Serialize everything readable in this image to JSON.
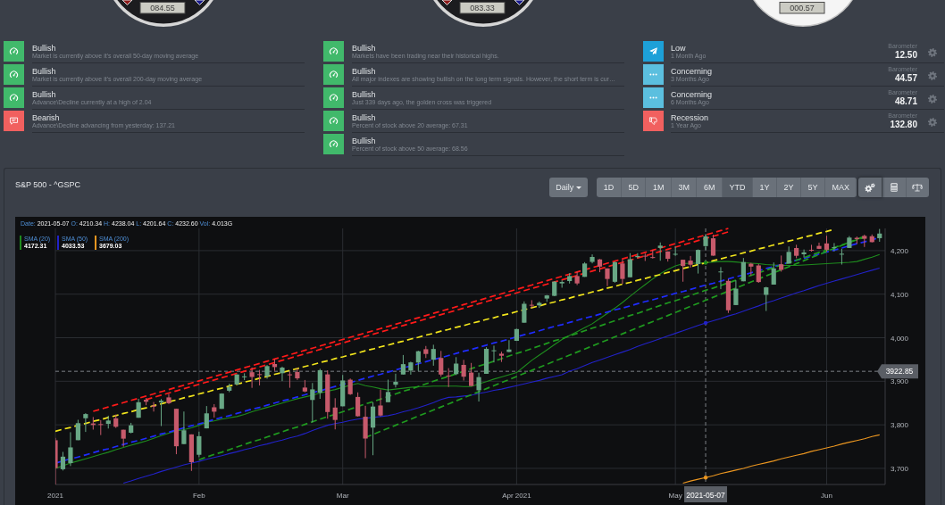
{
  "gauges": [
    {
      "kind": "dark",
      "reading": "084.55"
    },
    {
      "kind": "dark",
      "reading": "083.33"
    },
    {
      "kind": "light",
      "reading": "000.57"
    }
  ],
  "market_signals": [
    {
      "kind": "bullish",
      "title": "Bullish",
      "text": "Market is currently above it's overall 50-day moving average"
    },
    {
      "kind": "bullish",
      "title": "Bullish",
      "text": "Market is currently above it's overall 200-day moving average"
    },
    {
      "kind": "bullish",
      "title": "Bullish",
      "text": "Advance\\Decline currently at a high of 2.04"
    },
    {
      "kind": "bearish",
      "title": "Bearish",
      "text": "Advance\\Decline advancing from yesterday: 137.21"
    }
  ],
  "index_signals": [
    {
      "kind": "bullish",
      "title": "Bullish",
      "text": "Markets have been trading near their historical highs."
    },
    {
      "kind": "bullish",
      "title": "Bullish",
      "text": "All major indexes are showing bullish on the long term signals. However, the short term is cur…"
    },
    {
      "kind": "bullish",
      "title": "Bullish",
      "text": "Just 339 days ago, the golden cross was triggered"
    },
    {
      "kind": "bullish",
      "title": "Bullish",
      "text": "Percent of stock above 20 average: 67.31"
    },
    {
      "kind": "bullish",
      "title": "Bullish",
      "text": "Percent of stock above 50 average: 68.56"
    }
  ],
  "recession_barometer": [
    {
      "kind": "low",
      "title": "Low",
      "time": "1 Month Ago",
      "label": "Barometer",
      "value": "12.50"
    },
    {
      "kind": "concerning",
      "title": "Concerning",
      "time": "3 Months Ago",
      "label": "Barometer",
      "value": "44.57"
    },
    {
      "kind": "concerning",
      "title": "Concerning",
      "time": "6 Months Ago",
      "label": "Barometer",
      "value": "48.71"
    },
    {
      "kind": "recession",
      "title": "Recession",
      "time": "1 Year Ago",
      "label": "Barometer",
      "value": "132.80"
    }
  ],
  "chart_panel": {
    "title": "S&P 500 - ^GSPC",
    "interval": "Daily",
    "ranges": [
      {
        "label": "1D",
        "selected": false
      },
      {
        "label": "5D",
        "selected": false
      },
      {
        "label": "1M",
        "selected": false
      },
      {
        "label": "3M",
        "selected": false
      },
      {
        "label": "6M",
        "selected": false
      },
      {
        "label": "YTD",
        "selected": true
      },
      {
        "label": "1Y",
        "selected": false
      },
      {
        "label": "2Y",
        "selected": false
      },
      {
        "label": "5Y",
        "selected": false
      },
      {
        "label": "MAX",
        "selected": false
      }
    ],
    "tools": [
      {
        "kind": "gears",
        "selected": true
      },
      {
        "kind": "calculator",
        "selected": false
      },
      {
        "kind": "scale",
        "selected": false
      }
    ],
    "readout": [
      {
        "label": "Date:",
        "value": "2021-05-07"
      },
      {
        "label": "O:",
        "value": "4210.34"
      },
      {
        "label": "H:",
        "value": "4238.04"
      },
      {
        "label": "L:",
        "value": "4201.64"
      },
      {
        "label": "C:",
        "value": "4232.60"
      },
      {
        "label": "Vol:",
        "value": "4.013G"
      }
    ],
    "legend_readings": [
      "4172.31",
      "4033.53",
      "3679.03"
    ],
    "chart_data": {
      "type": "candlestick",
      "grid": true,
      "legend": "upper left",
      "ylim": [
        3663,
        4251
      ],
      "yticks": [
        {
          "value": 3700,
          "label": "3,700"
        },
        {
          "value": 3800,
          "label": "3,800"
        },
        {
          "value": 3900,
          "label": "3,900"
        },
        {
          "value": 4000,
          "label": "4,000"
        },
        {
          "value": 4100,
          "label": "4,100"
        },
        {
          "value": 4200,
          "label": "4,200"
        }
      ],
      "categories": [
        "2021",
        null,
        null,
        null,
        null,
        null,
        null,
        null,
        null,
        null,
        null,
        null,
        null,
        null,
        null,
        null,
        null,
        null,
        null,
        "Feb",
        null,
        null,
        null,
        null,
        null,
        null,
        null,
        null,
        null,
        null,
        null,
        null,
        null,
        null,
        null,
        null,
        null,
        null,
        "Mar",
        null,
        null,
        null,
        null,
        null,
        null,
        null,
        null,
        null,
        null,
        null,
        null,
        null,
        null,
        null,
        null,
        null,
        null,
        null,
        null,
        null,
        null,
        "Apr 2021",
        null,
        null,
        null,
        null,
        null,
        null,
        null,
        null,
        null,
        null,
        null,
        null,
        null,
        null,
        null,
        null,
        null,
        null,
        null,
        null,
        "May",
        null,
        null,
        null,
        "2021-05-07",
        null,
        null,
        null,
        null,
        null,
        null,
        null,
        null,
        null,
        null,
        null,
        null,
        null,
        null,
        null,
        "Jun",
        null,
        null,
        null,
        null,
        null,
        null,
        null
      ],
      "ohlc": [
        [
          3764.61,
          3769.99,
          3662.71,
          3700.65
        ],
        [
          3698.02,
          3737.83,
          3695.07,
          3726.86
        ],
        [
          3712.2,
          3783.04,
          3705.34,
          3748.14
        ],
        [
          3764.71,
          3811.55,
          3764.71,
          3803.79
        ],
        [
          3815.05,
          3826.69,
          3783.6,
          3824.68
        ],
        [
          3803.14,
          3817.86,
          3789.02,
          3799.61
        ],
        [
          3801.62,
          3810.78,
          3776.51,
          3801.19
        ],
        [
          3802.23,
          3820.96,
          3791.5,
          3809.84
        ],
        [
          3814.98,
          3823.6,
          3792.86,
          3795.54
        ],
        [
          3788.73,
          3788.73,
          3749.62,
          3768.25
        ],
        [
          3781.88,
          3804.53,
          3780.37,
          3798.91
        ],
        [
          3816.22,
          3859.75,
          3816.22,
          3851.85
        ],
        [
          3857.46,
          3861.45,
          3845.05,
          3853.07
        ],
        [
          3844.24,
          3852.31,
          3830.41,
          3841.47
        ],
        [
          3851.68,
          3859.23,
          3797.16,
          3855.36
        ],
        [
          3862.96,
          3870.9,
          3847.78,
          3849.62
        ],
        [
          3836.83,
          3836.83,
          3732.48,
          3750.77
        ],
        [
          3755.75,
          3830.5,
          3755.75,
          3787.38
        ],
        [
          3778.05,
          3778.05,
          3694.12,
          3714.24
        ],
        [
          3731.17,
          3784.32,
          3725.62,
          3773.86
        ],
        [
          3791.84,
          3843.09,
          3791.84,
          3826.31
        ],
        [
          3840.27,
          3847.51,
          3816.68,
          3830.17
        ],
        [
          3836.66,
          3872.42,
          3836.66,
          3871.74
        ],
        [
          3878.3,
          3894.56,
          3874.93,
          3886.83
        ],
        [
          3892.59,
          3915.77,
          3892.59,
          3915.59
        ],
        [
          3910.49,
          3918.35,
          3902.64,
          3911.23
        ],
        [
          3920.78,
          3931.5,
          3884.94,
          3909.88
        ],
        [
          3916.4,
          3925.99,
          3890.39,
          3916.38
        ],
        [
          3911.65,
          3937.23,
          3905.78,
          3934.83
        ],
        [
          3939.61,
          3950.43,
          3923.85,
          3932.59
        ],
        [
          3918.5,
          3933.61,
          3900.43,
          3931.33
        ],
        [
          3915.86,
          3921.98,
          3885.03,
          3913.97
        ],
        [
          3921.16,
          3930.41,
          3903.07,
          3906.71
        ],
        [
          3885.55,
          3902.92,
          3874.71,
          3876.5
        ],
        [
          3857.07,
          3895.98,
          3805.59,
          3881.37
        ],
        [
          3873.71,
          3928.65,
          3859.6,
          3925.43
        ],
        [
          3915.8,
          3925.02,
          3814.04,
          3829.34
        ],
        [
          3839.66,
          3861.08,
          3789.54,
          3811.15
        ],
        [
          3842.51,
          3914.5,
          3842.51,
          3901.82
        ],
        [
          3903.64,
          3906.41,
          3868.57,
          3870.29
        ],
        [
          3863.99,
          3874.47,
          3818.86,
          3819.72
        ],
        [
          3818.53,
          3843.67,
          3723.34,
          3768.47
        ],
        [
          3793.58,
          3851.69,
          3730.19,
          3841.94
        ],
        [
          3844.39,
          3881.06,
          3819.25,
          3821.35
        ],
        [
          3851.93,
          3903.76,
          3851.93,
          3875.44
        ],
        [
          3891.99,
          3917.35,
          3885.73,
          3898.81
        ],
        [
          3915.54,
          3960.27,
          3915.54,
          3939.34
        ],
        [
          3924.52,
          3944.99,
          3915.21,
          3943.34
        ],
        [
          3942.96,
          3970.08,
          3923.54,
          3968.94
        ],
        [
          3973.59,
          3981.04,
          3953.44,
          3962.71
        ],
        [
          3949.57,
          3983.87,
          3935.74,
          3974.12
        ],
        [
          3953.5,
          3969.62,
          3910.86,
          3915.46
        ],
        [
          3913.14,
          3930.12,
          3886.75,
          3913.1
        ],
        [
          3916.48,
          3955.31,
          3914.16,
          3940.59
        ],
        [
          3937.6,
          3949.13,
          3901.57,
          3910.52
        ],
        [
          3919.93,
          3942.08,
          3889.07,
          3889.14
        ],
        [
          3879.34,
          3919.54,
          3853.5,
          3909.52
        ],
        [
          3917.12,
          3978.19,
          3917.12,
          3974.54
        ],
        [
          3969.31,
          3981.83,
          3943.25,
          3971.09
        ],
        [
          3963.34,
          3968.01,
          3944.35,
          3958.55
        ],
        [
          3967.25,
          3994.41,
          3966.98,
          3972.89
        ],
        [
          3992.78,
          4020.63,
          3992.78,
          4019.87
        ],
        [
          4034.44,
          4083.42,
          4034.44,
          4077.91
        ],
        [
          4075.57,
          4086.23,
          4068.14,
          4073.94
        ],
        [
          4074.29,
          4083.13,
          4068.31,
          4079.95
        ],
        [
          4089.95,
          4098.19,
          4082.54,
          4097.17
        ],
        [
          4096.11,
          4129.48,
          4095.51,
          4128.8
        ],
        [
          4124.71,
          4131.76,
          4114.82,
          4127.99
        ],
        [
          4130.1,
          4148,
          4124.43,
          4141.59
        ],
        [
          4141.58,
          4151.69,
          4120.87,
          4124.66
        ],
        [
          4139.76,
          4173.49,
          4139.76,
          4170.42
        ],
        [
          4174.14,
          4191.31,
          4170.75,
          4185.47
        ],
        [
          4179.8,
          4180.81,
          4150.47,
          4163.26
        ],
        [
          4159.18,
          4159.18,
          4118.38,
          4134.94
        ],
        [
          4128.42,
          4175.02,
          4126.35,
          4173.42
        ],
        [
          4170.46,
          4179.57,
          4123.69,
          4134.98
        ],
        [
          4138.78,
          4194.17,
          4138.78,
          4180.17
        ],
        [
          4185.03,
          4194.19,
          4182.36,
          4187.62
        ],
        [
          4188.25,
          4193.35,
          4176.22,
          4186.72
        ],
        [
          4185.14,
          4201.53,
          4181.78,
          4183.18
        ],
        [
          4206.14,
          4218.78,
          4176.81,
          4211.47
        ],
        [
          4198.1,
          4198.1,
          4174.85,
          4181.17
        ],
        [
          4191.98,
          4209.39,
          4188.03,
          4192.66
        ],
        [
          4179.04,
          4179.04,
          4128.59,
          4164.66
        ],
        [
          4177.06,
          4187.72,
          4160.94,
          4167.59
        ],
        [
          4169.14,
          4202.7,
          4147.33,
          4201.62
        ],
        [
          4210.34,
          4238.04,
          4201.64,
          4232.6
        ],
        [
          4228.29,
          4236.39,
          4188.13,
          4188.43
        ],
        [
          4150.34,
          4162.04,
          4111.53,
          4152.1
        ],
        [
          4130.55,
          4134.73,
          4056.88,
          4063.04
        ],
        [
          4074.99,
          4131.58,
          4074.99,
          4112.5
        ],
        [
          4129.58,
          4183.13,
          4129.58,
          4173.85
        ],
        [
          4169.92,
          4171.92,
          4142.69,
          4163.29
        ],
        [
          4165.94,
          4169.15,
          4125.99,
          4127.83
        ],
        [
          4098.45,
          4116.93,
          4061.41,
          4115.68
        ],
        [
          4121.97,
          4172.8,
          4121.97,
          4159.12
        ],
        [
          4168.61,
          4188.72,
          4151.72,
          4155.86
        ],
        [
          4170.16,
          4209.52,
          4170.16,
          4197.05
        ],
        [
          4205.94,
          4213.42,
          4182.52,
          4188.13
        ],
        [
          4191.59,
          4202.61,
          4184.11,
          4195.99
        ],
        [
          4201.94,
          4213.38,
          4197.78,
          4200.88
        ],
        [
          4210.77,
          4218.36,
          4203.57,
          4204.11
        ],
        [
          4216.52,
          4234.12,
          4197.59,
          4202.04
        ],
        [
          4206.82,
          4217.37,
          4198.27,
          4208.12
        ],
        [
          4191.43,
          4204.39,
          4167.93,
          4192.85
        ],
        [
          4206.05,
          4233.45,
          4206.05,
          4229.89
        ],
        [
          4229.34,
          4232.34,
          4215.66,
          4226.52
        ],
        [
          4233.81,
          4236.74,
          4208.41,
          4227.26
        ],
        [
          4232.99,
          4237.09,
          4218.74,
          4219.55
        ],
        [
          4228.56,
          4249.74,
          4220.34,
          4239.18
        ]
      ],
      "series": [
        {
          "type": "line",
          "name": "SMA (20)",
          "color": "#1e8c1e",
          "values": [
            3700,
            3706,
            3712,
            3717,
            3722,
            3727,
            3732,
            3737,
            3743,
            3748,
            3753,
            3758,
            3763,
            3769,
            3775,
            3781,
            3786,
            3789,
            3793,
            3799,
            3806,
            3809,
            3813,
            3816,
            3819,
            3824,
            3830,
            3835,
            3840,
            3845,
            3850,
            3855,
            3860,
            3864,
            3868,
            3873,
            3877,
            3881,
            3886,
            3891,
            3895,
            3890,
            3887,
            3883,
            3880,
            3882,
            3884,
            3886,
            3888,
            3888,
            3889,
            3889,
            3889,
            3889,
            3888,
            3888,
            3894,
            3899,
            3905,
            3910,
            3915,
            3920,
            3934,
            3948,
            3960,
            3972,
            3984,
            3996,
            4005,
            4014,
            4023,
            4032,
            4044,
            4056,
            4068,
            4081,
            4095,
            4109,
            4122,
            4135,
            4147,
            4157,
            4165,
            4170,
            4171,
            4171,
            4172,
            4174,
            4175,
            4175,
            4174,
            4172,
            4171,
            4170,
            4168,
            4167,
            4166,
            4166,
            4166,
            4167,
            4168,
            4169,
            4170,
            4171,
            4172,
            4173,
            4175,
            4180,
            4185,
            4191
          ]
        },
        {
          "type": "line",
          "name": "SMA (50)",
          "color": "#2222c8",
          "values": [
            null,
            null,
            null,
            null,
            null,
            null,
            null,
            null,
            null,
            3666,
            3671,
            3677,
            3682,
            3687,
            3693,
            3698,
            3703,
            3708,
            3712,
            3716,
            3721,
            3725,
            3729,
            3734,
            3738,
            3743,
            3747,
            3752,
            3756,
            3761,
            3765,
            3770,
            3774,
            3780,
            3787,
            3793,
            3799,
            3803,
            3806,
            3810,
            3813,
            3815,
            3817,
            3819,
            3821,
            3825,
            3830,
            3834,
            3839,
            3845,
            3851,
            3858,
            3863,
            3864,
            3866,
            3868,
            3872,
            3875,
            3879,
            3882,
            3886,
            3890,
            3894,
            3898,
            3902,
            3907,
            3911,
            3915,
            3923,
            3929,
            3936,
            3943,
            3949,
            3955,
            3961,
            3967,
            3973,
            3980,
            3986,
            3992,
            3998,
            4004,
            4010,
            4016,
            4022,
            4028,
            4034,
            4039,
            4044,
            4050,
            4055,
            4061,
            4067,
            4073,
            4080,
            4085,
            4091,
            4097,
            4103,
            4108,
            4114,
            4120,
            4125,
            4130,
            4135,
            4140,
            4145,
            4150,
            4155,
            4160
          ]
        },
        {
          "type": "line",
          "name": "SMA (200)",
          "color": "#eb9620",
          "values": [
            null,
            null,
            null,
            null,
            null,
            null,
            null,
            null,
            null,
            null,
            null,
            null,
            null,
            null,
            null,
            null,
            null,
            null,
            null,
            null,
            null,
            null,
            null,
            null,
            null,
            null,
            null,
            null,
            null,
            null,
            null,
            null,
            null,
            null,
            null,
            null,
            null,
            null,
            null,
            null,
            null,
            null,
            null,
            null,
            null,
            null,
            null,
            null,
            null,
            null,
            null,
            null,
            null,
            null,
            null,
            null,
            null,
            null,
            null,
            null,
            null,
            null,
            null,
            null,
            null,
            null,
            null,
            null,
            null,
            null,
            null,
            null,
            null,
            null,
            null,
            null,
            null,
            null,
            null,
            null,
            null,
            null,
            null,
            3666,
            3671,
            3675,
            3679,
            3683,
            3688,
            3692,
            3696,
            3700,
            3705,
            3709,
            3713,
            3717,
            3722,
            3726,
            3730,
            3734,
            3739,
            3743,
            3747,
            3751,
            3756,
            3760,
            3764,
            3768,
            3773,
            3777
          ]
        },
        {
          "type": "line",
          "line_style": "dashed",
          "color": "#ff1a1a",
          "values": [
            null,
            null,
            null,
            null,
            null,
            3831,
            3836,
            3841,
            3846,
            3851,
            3856,
            3861,
            3866,
            3871,
            3876,
            3881,
            3886,
            3891,
            3896,
            3901,
            3906,
            3911,
            3916,
            3921,
            3926,
            3931,
            3936,
            3941,
            3946,
            3951,
            3956,
            3961,
            3966,
            3971,
            3976,
            3981,
            3986,
            3991,
            3996,
            4001,
            4006,
            4011,
            4016,
            4021,
            4026,
            4031,
            4036,
            4041,
            4046,
            4051,
            4056,
            4061,
            4066,
            4071,
            4076,
            4081,
            4086,
            4091,
            4096,
            4101,
            4106,
            4111,
            4116,
            4121,
            4126,
            4131,
            4136,
            4141,
            4146,
            4151,
            4156,
            4161,
            4166,
            4171,
            4176,
            4181,
            4186,
            4191,
            4196,
            4201,
            4206,
            4211,
            4216,
            4221,
            4226,
            4231,
            4236,
            4241,
            4246,
            4251,
            null,
            null,
            null,
            null,
            null,
            null,
            null,
            null,
            null,
            null,
            null,
            null,
            null,
            null,
            null,
            null,
            null,
            null,
            null,
            null
          ]
        },
        {
          "type": "line",
          "line_style": "dashed",
          "color": "#ff1a1a",
          "values": [
            null,
            null,
            null,
            null,
            null,
            null,
            null,
            null,
            null,
            null,
            null,
            null,
            3858,
            3863,
            3868,
            3873,
            3878,
            3883,
            3888,
            3893,
            3898,
            3903,
            3908,
            3913,
            3918,
            3923,
            3928,
            3933,
            3938,
            3943,
            3948,
            3953,
            3958,
            3963,
            3968,
            3973,
            3978,
            3983,
            3988,
            3993,
            3998,
            4003,
            4008,
            4013,
            4018,
            4023,
            4028,
            4033,
            4038,
            4043,
            4048,
            4053,
            4058,
            4063,
            4068,
            4073,
            4078,
            4083,
            4088,
            4093,
            4098,
            4103,
            4108,
            4113,
            4118,
            4123,
            4128,
            4133,
            4138,
            4143,
            4148,
            4153,
            4158,
            4163,
            4168,
            4173,
            4178,
            4183,
            4188,
            4193,
            4198,
            4203,
            4208,
            4213,
            4218,
            4223,
            4228,
            4233,
            4238,
            4243,
            null,
            null,
            null,
            null,
            null,
            null,
            null,
            null,
            null,
            null,
            null,
            null,
            null,
            null,
            null,
            null,
            null,
            null,
            null,
            null
          ]
        },
        {
          "type": "line",
          "line_style": "dashed",
          "color": "#f2e51c",
          "values": [
            3785,
            3790,
            3794,
            3799,
            3803,
            3808,
            3812,
            3817,
            3821,
            3826,
            3830,
            3835,
            3839,
            3844,
            3848,
            3853,
            3857,
            3862,
            3866,
            3871,
            3875,
            3880,
            3884,
            3889,
            3893,
            3898,
            3902,
            3907,
            3911,
            3916,
            3920,
            3925,
            3929,
            3934,
            3938,
            3943,
            3947,
            3952,
            3956,
            3961,
            3965,
            3970,
            3974,
            3979,
            3983,
            3988,
            3992,
            3997,
            4001,
            4006,
            4010,
            4015,
            4019,
            4024,
            4028,
            4033,
            4037,
            4042,
            4046,
            4051,
            4055,
            4060,
            4064,
            4069,
            4073,
            4078,
            4082,
            4087,
            4091,
            4096,
            4100,
            4105,
            4109,
            4114,
            4118,
            4123,
            4127,
            4132,
            4136,
            4141,
            4145,
            4150,
            4154,
            4159,
            4163,
            4168,
            4172,
            4177,
            4181,
            4186,
            4190,
            4195,
            4199,
            4204,
            4208,
            4213,
            4217,
            4222,
            4226,
            4231,
            4235,
            4240,
            4244,
            4249,
            null,
            null,
            null,
            null,
            null,
            null
          ]
        },
        {
          "type": "line",
          "line_style": "dashed",
          "color": "#1f2cff",
          "values": [
            3712,
            3717,
            3722,
            3726,
            3731,
            3736,
            3741,
            3745,
            3750,
            3755,
            3760,
            3764,
            3769,
            3774,
            3779,
            3783,
            3788,
            3793,
            3798,
            3802,
            3807,
            3812,
            3817,
            3821,
            3826,
            3831,
            3836,
            3840,
            3845,
            3850,
            3855,
            3859,
            3864,
            3869,
            3874,
            3878,
            3883,
            3888,
            3893,
            3897,
            3902,
            3907,
            3912,
            3916,
            3921,
            3926,
            3931,
            3935,
            3940,
            3945,
            3950,
            3954,
            3959,
            3964,
            3969,
            3973,
            3978,
            3983,
            3988,
            3992,
            3997,
            4002,
            4007,
            4011,
            4016,
            4021,
            4026,
            4030,
            4035,
            4040,
            4045,
            4049,
            4054,
            4059,
            4064,
            4068,
            4073,
            4078,
            4083,
            4087,
            4092,
            4097,
            4102,
            4106,
            4111,
            4116,
            4121,
            4125,
            4130,
            4135,
            4140,
            4144,
            4149,
            4154,
            4159,
            4163,
            4168,
            4173,
            4178,
            4182,
            4187,
            4192,
            4197,
            4201,
            4206,
            4211,
            4216,
            4220,
            4225,
            4230
          ]
        },
        {
          "type": "line",
          "line_style": "dashed",
          "color": "#1f9a1f",
          "values": [
            null,
            null,
            null,
            null,
            null,
            null,
            null,
            null,
            null,
            null,
            null,
            null,
            null,
            null,
            null,
            null,
            null,
            null,
            null,
            3720,
            3726,
            3732,
            3737,
            3743,
            3749,
            3755,
            3761,
            3766,
            3772,
            3778,
            3784,
            3790,
            3795,
            3801,
            3807,
            3813,
            3819,
            3824,
            3830,
            3836,
            3842,
            3848,
            3853,
            3859,
            3865,
            3871,
            3877,
            3882,
            3888,
            3894,
            3900,
            3906,
            3911,
            3917,
            3923,
            3929,
            3935,
            3940,
            3946,
            3952,
            3958,
            3964,
            3969,
            3975,
            3981,
            3987,
            3993,
            3998,
            4004,
            4010,
            4016,
            4022,
            4027,
            4033,
            4039,
            4045,
            4051,
            4056,
            4062,
            4068,
            4074,
            4080,
            4085,
            4091,
            4097,
            4103,
            4109,
            4114,
            4120,
            4126,
            4132,
            4138,
            4143,
            4149,
            4155,
            4161,
            4167,
            4172,
            4178,
            4184,
            4190,
            4196,
            4201,
            4207,
            4213,
            4219,
            4225,
            4230,
            null,
            null
          ]
        },
        {
          "type": "line",
          "line_style": "dashed",
          "color": "#1f9a1f",
          "values": [
            null,
            null,
            null,
            null,
            null,
            null,
            null,
            null,
            null,
            null,
            null,
            null,
            null,
            null,
            null,
            null,
            null,
            null,
            null,
            null,
            null,
            null,
            null,
            null,
            null,
            null,
            null,
            null,
            null,
            null,
            null,
            null,
            null,
            null,
            null,
            null,
            null,
            null,
            null,
            null,
            null,
            3771,
            3778,
            3785,
            3792,
            3799,
            3806,
            3813,
            3820,
            3827,
            3834,
            3841,
            3848,
            3855,
            3862,
            3869,
            3876,
            3883,
            3890,
            3897,
            3904,
            3911,
            3918,
            3925,
            3932,
            3939,
            3946,
            3953,
            3960,
            3967,
            3974,
            3981,
            3988,
            3995,
            4002,
            4009,
            4016,
            4023,
            4030,
            4037,
            4044,
            4051,
            4058,
            4065,
            4072,
            4079,
            4086,
            4093,
            4100,
            4107,
            4114,
            4121,
            4128,
            4135,
            4142,
            4149,
            4156,
            4163,
            4170,
            4177,
            4184,
            4191,
            4198,
            4205,
            4212,
            4219,
            4226,
            4233,
            null,
            null
          ]
        }
      ],
      "ref_lines": [
        {
          "axis": "y",
          "value": 3922.85,
          "label": "3922.85"
        },
        {
          "axis": "x",
          "value": "2021-05-07"
        }
      ]
    }
  }
}
